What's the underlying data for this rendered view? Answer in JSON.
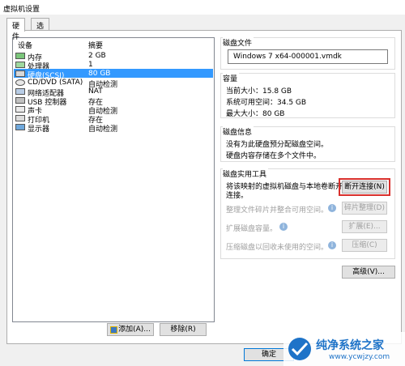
{
  "window": {
    "title": "虚拟机设置"
  },
  "tabs": [
    {
      "label": "硬件"
    },
    {
      "label": "选项"
    }
  ],
  "device_list": {
    "headers": {
      "device": "设备",
      "summary": "摘要"
    },
    "items": [
      {
        "name": "内存",
        "summary": "2 GB",
        "icon": "memory-icon"
      },
      {
        "name": "处理器",
        "summary": "1",
        "icon": "processor-icon"
      },
      {
        "name": "硬盘(SCSI)",
        "summary": "80 GB",
        "icon": "harddisk-icon",
        "selected": true
      },
      {
        "name": "CD/DVD (SATA)",
        "summary": "自动检测",
        "icon": "cdrom-icon"
      },
      {
        "name": "网络适配器",
        "summary": "NAT",
        "icon": "network-icon"
      },
      {
        "name": "USB 控制器",
        "summary": "存在",
        "icon": "usb-icon"
      },
      {
        "name": "声卡",
        "summary": "自动检测",
        "icon": "sound-icon"
      },
      {
        "name": "打印机",
        "summary": "存在",
        "icon": "printer-icon"
      },
      {
        "name": "显示器",
        "summary": "自动检测",
        "icon": "display-icon"
      }
    ]
  },
  "buttons": {
    "add": "添加(A)...",
    "remove": "移除(R)",
    "ok": "确定",
    "advanced": "高级(V)..."
  },
  "disk_file": {
    "title": "磁盘文件",
    "value": "Windows 7 x64-000001.vmdk"
  },
  "capacity": {
    "title": "容量",
    "current": "当前大小：15.8 GB",
    "free": "系统可用空间：34.5 GB",
    "max": "最大大小：80 GB"
  },
  "disk_info": {
    "title": "磁盘信息",
    "line1": "没有为此硬盘预分配磁盘空间。",
    "line2": "硬盘内容存储在多个文件中。"
  },
  "utilities": {
    "title": "磁盘实用工具",
    "map_text_1": "将该映射的虚拟机磁盘与本地卷断开",
    "map_text_2": "连接。",
    "disconnect": "断开连接(N)",
    "defrag_text": "整理文件碎片并整合可用空间。",
    "defrag": "碎片整理(D)",
    "expand_text": "扩展磁盘容量。",
    "expand": "扩展(E)...",
    "compact_text": "压缩磁盘以回收未使用的空间。",
    "compact": "压缩(C)"
  },
  "watermark": {
    "text": "纯净系统之家",
    "url": "www.ycwjzy.com"
  },
  "colors": {
    "selection": "#3399ff",
    "highlight": "#d9302c",
    "brand": "#1e73c8"
  }
}
